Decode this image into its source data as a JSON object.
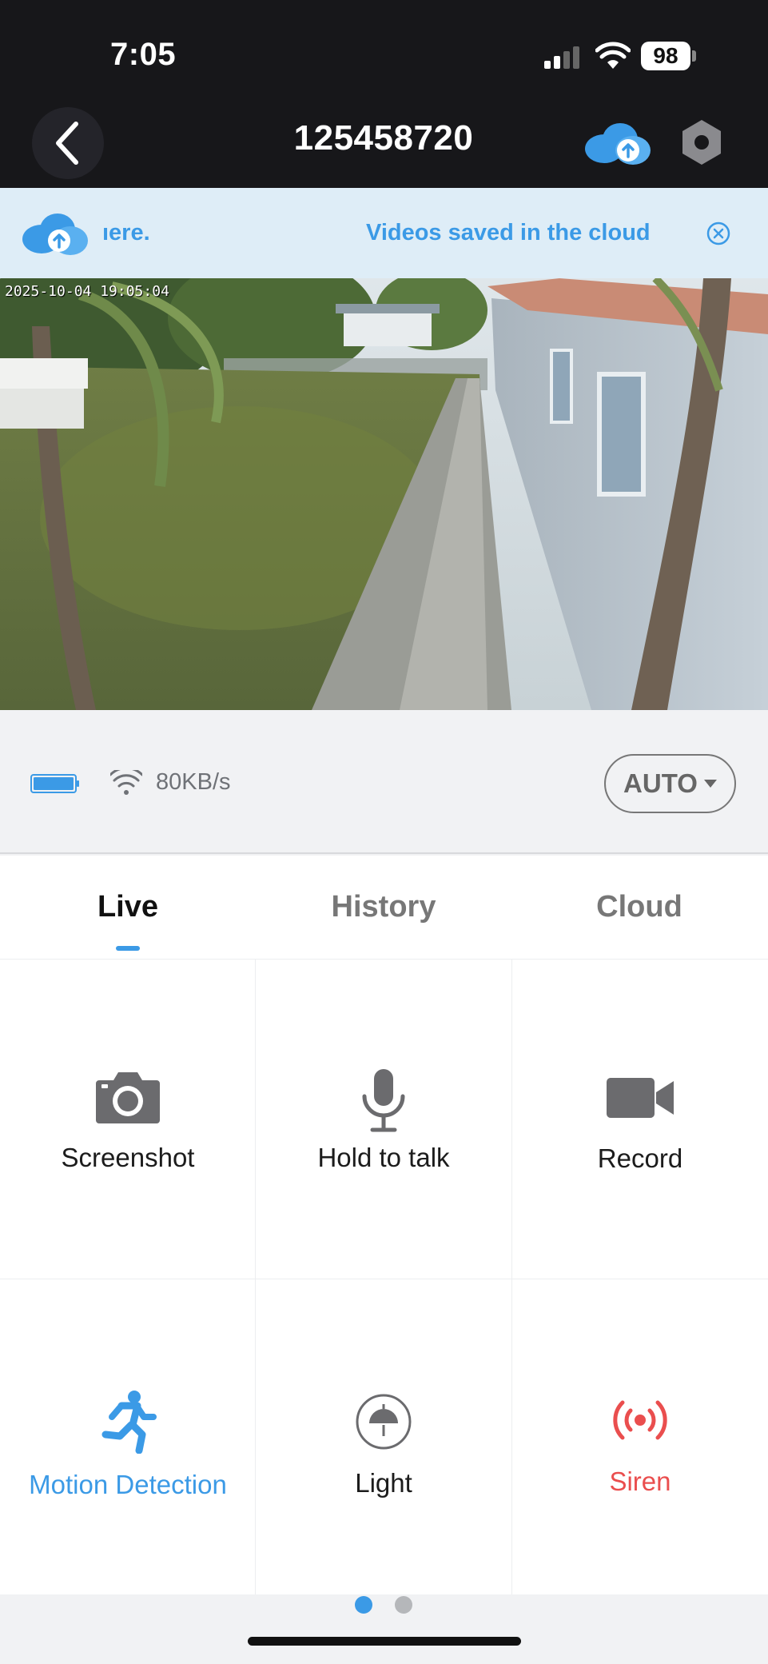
{
  "status_bar": {
    "time": "7:05",
    "battery": "98"
  },
  "header": {
    "title": "125458720"
  },
  "banner": {
    "scroll_text": "ıere.",
    "message": "Videos saved in the cloud"
  },
  "video": {
    "timestamp": "2025-10-04 19:05:04"
  },
  "info": {
    "speed": "80KB/s",
    "quality": "AUTO"
  },
  "tabs": [
    {
      "label": "Live",
      "active": true
    },
    {
      "label": "History",
      "active": false
    },
    {
      "label": "Cloud",
      "active": false
    }
  ],
  "controls": [
    {
      "label": "Screenshot",
      "icon": "camera-icon"
    },
    {
      "label": "Hold to talk",
      "icon": "microphone-icon"
    },
    {
      "label": "Record",
      "icon": "video-camera-icon"
    },
    {
      "label": "Motion Detection",
      "icon": "running-person-icon"
    },
    {
      "label": "Light",
      "icon": "lamp-icon"
    },
    {
      "label": "Siren",
      "icon": "siren-icon"
    }
  ],
  "colors": {
    "accent": "#3b9ae6",
    "alert": "#ea4e4e",
    "header_bg": "#17171a",
    "banner_bg": "#deedf7"
  },
  "pagination": {
    "pages": 2,
    "current": 1
  }
}
